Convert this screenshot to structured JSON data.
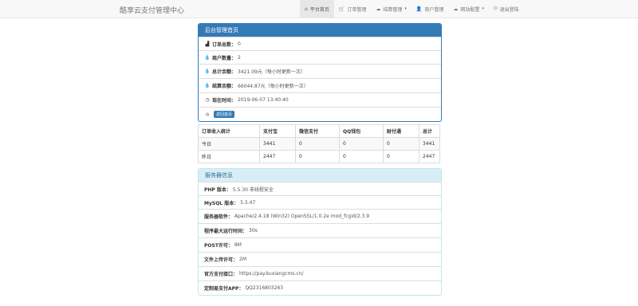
{
  "navbar": {
    "brand": "酷享云支付管理中心",
    "items": [
      {
        "label": "平台首页",
        "icon": "home-icon",
        "glyph": "⌂"
      },
      {
        "label": "订单管理",
        "icon": "cart-icon",
        "glyph": "🛒"
      },
      {
        "label": "结算管理",
        "icon": "cloud-icon",
        "glyph": "☁",
        "dropdown": true
      },
      {
        "label": "商户管理",
        "icon": "user-icon",
        "glyph": "👤"
      },
      {
        "label": "网站配置",
        "icon": "cloud-icon",
        "glyph": "☁",
        "dropdown": true
      },
      {
        "label": "退出登陆",
        "icon": "logout-icon",
        "glyph": "⏻"
      }
    ]
  },
  "overview": {
    "title": "后台管理首页",
    "rows": [
      {
        "label": "订单总数：",
        "value": "0",
        "icon": "bar-chart-icon",
        "glyph": "▟"
      },
      {
        "label": "商户数量：",
        "value": "2",
        "icon": "tint-icon",
        "glyph": "💧"
      },
      {
        "label": "总计余额：",
        "value": "3421.09元（每小时更新一次）",
        "icon": "tint-icon",
        "glyph": "💧"
      },
      {
        "label": "结算余额：",
        "value": "66044.87元（每小时更新一次）",
        "icon": "tint-icon",
        "glyph": "💧"
      },
      {
        "label": "现在时间：",
        "value": "2019-06-07 13:40:40",
        "icon": "clock-icon",
        "glyph": "◷"
      }
    ],
    "back_label": "返回首页"
  },
  "income_table": {
    "headers": [
      "订单收入统计",
      "支付宝",
      "微信支付",
      "QQ钱包",
      "财付通",
      "总计"
    ],
    "rows": [
      [
        "今日",
        "3441",
        "0",
        "0",
        "0",
        "3441"
      ],
      [
        "昨日",
        "2447",
        "0",
        "0",
        "0",
        "2447"
      ]
    ]
  },
  "server_info": {
    "title": "服务器信息",
    "rows": [
      {
        "label": "PHP 版本：",
        "value": "5.5.30 非线程安全"
      },
      {
        "label": "MySQL 版本：",
        "value": "5.5.47"
      },
      {
        "label": "服务器软件：",
        "value": "Apache/2.4.18 (Win32) OpenSSL/1.0.2e mod_fcgid/2.3.9"
      },
      {
        "label": "程序最大运行时间：",
        "value": "30s"
      },
      {
        "label": "POST许可：",
        "value": "8M"
      },
      {
        "label": "文件上传许可：",
        "value": "2M"
      },
      {
        "label": "官方支付接口：",
        "value": "https://pay.kuxiangcms.cn/"
      },
      {
        "label": "定制易支付APP：",
        "value": "QQ2316803263"
      }
    ]
  },
  "colors": {
    "primary": "#337ab7",
    "info_bg": "#d9edf7",
    "success_bg": "#dff0d8"
  }
}
